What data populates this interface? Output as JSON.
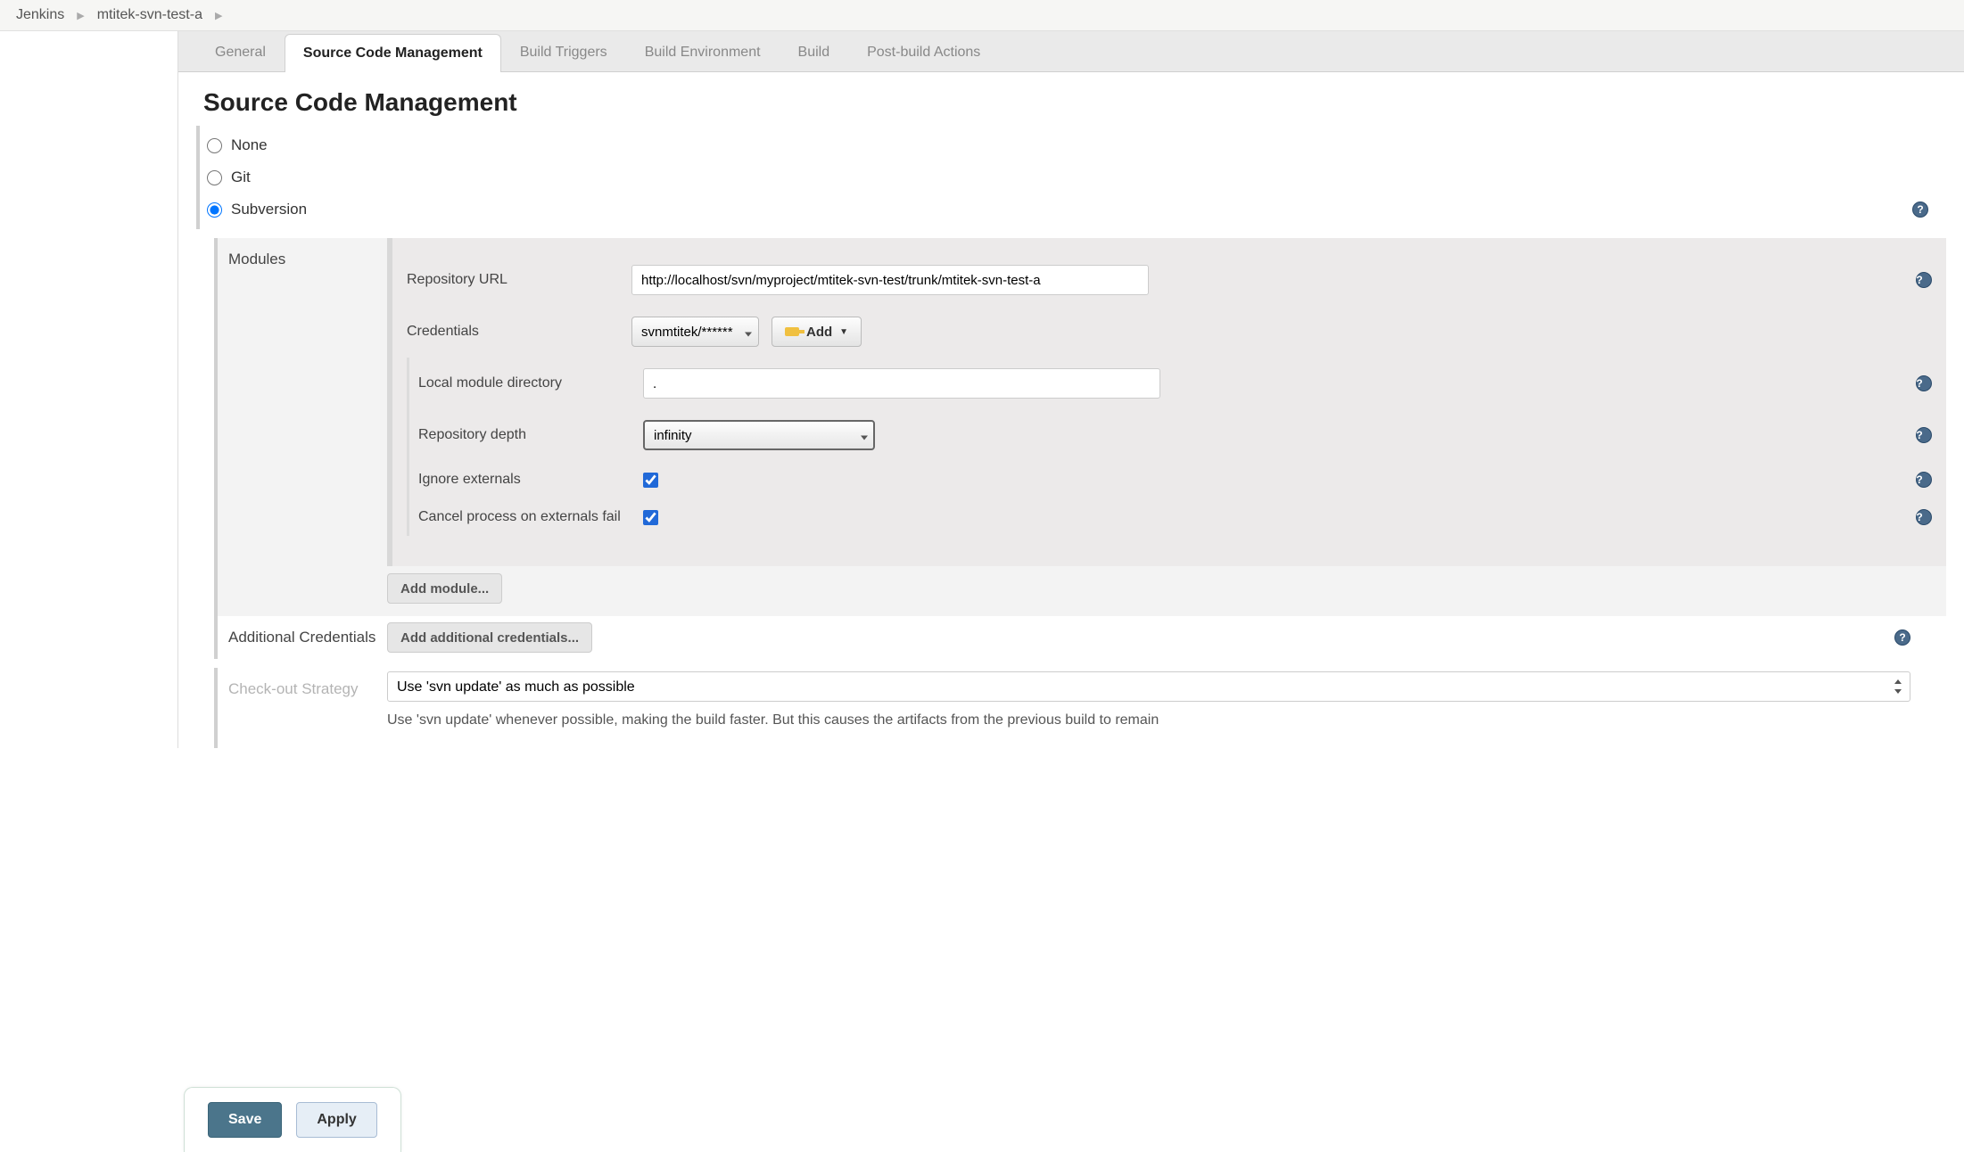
{
  "breadcrumb": {
    "root": "Jenkins",
    "job": "mtitek-svn-test-a"
  },
  "tabs": {
    "general": "General",
    "scm": "Source Code Management",
    "triggers": "Build Triggers",
    "env": "Build Environment",
    "build": "Build",
    "post": "Post-build Actions"
  },
  "title": "Source Code Management",
  "scm_options": {
    "none": "None",
    "git": "Git",
    "svn": "Subversion"
  },
  "modules": {
    "label": "Modules",
    "repo_url_label": "Repository URL",
    "repo_url_value": "http://localhost/svn/myproject/mtitek-svn-test/trunk/mtitek-svn-test-a",
    "credentials_label": "Credentials",
    "credentials_value": "svnmtitek/******",
    "add_button": "Add",
    "local_dir_label": "Local module directory",
    "local_dir_value": ".",
    "depth_label": "Repository depth",
    "depth_value": "infinity",
    "ignore_externals_label": "Ignore externals",
    "cancel_externals_label": "Cancel process on externals fail",
    "add_module_button": "Add module..."
  },
  "additional_credentials": {
    "label": "Additional Credentials",
    "button": "Add additional credentials..."
  },
  "checkout": {
    "label": "Check-out Strategy",
    "value": "Use 'svn update' as much as possible",
    "desc": "Use 'svn update' whenever possible, making the build faster. But this causes the artifacts from the previous build to remain"
  },
  "actions": {
    "save": "Save",
    "apply": "Apply"
  }
}
